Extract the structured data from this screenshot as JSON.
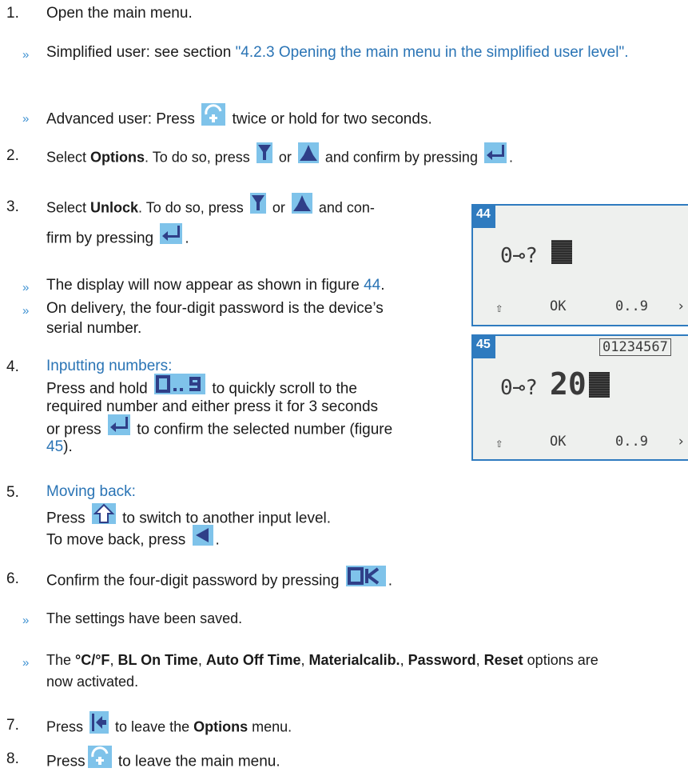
{
  "step1": {
    "num": "1.",
    "text": "Open the main menu."
  },
  "b1a": {
    "bullet": "»",
    "pre": "Simplified user: see section ",
    "link": "\"4.2.3 Opening the main menu in the simplified user level\"."
  },
  "b1b": {
    "bullet": "»",
    "pre": "Advanced user: Press",
    "post": "twice or hold for two seconds."
  },
  "step2": {
    "num": "2.",
    "pre": "Select ",
    "bold": "Options",
    "mid": ". To do so, press",
    "or": "or",
    "post": "and confirm by pressing",
    "end": "."
  },
  "step3": {
    "num": "3.",
    "pre": "Select ",
    "bold": "Unlock",
    "mid": ". To do so, press",
    "or": "or",
    "post": "and con-",
    "line2": "firm by pressing",
    "end": "."
  },
  "b3a": {
    "bullet": "»",
    "pre": "The display will now appear as shown in figure ",
    "link": "44",
    "end": "."
  },
  "b3b": {
    "bullet": "»",
    "line1": "On delivery, the four-digit password is the device’s",
    "line2": "serial number."
  },
  "step4": {
    "num": "4.",
    "title": "Inputting numbers:",
    "l1a": "Press and hold",
    "l1b": "to quickly scroll to the",
    "l2": "required number and either press it for 3 seconds",
    "l3a": "or press",
    "l3b": "to confirm the selected number (figure",
    "l4link": "45",
    "l4end": ")."
  },
  "step5": {
    "num": "5.",
    "title": "Moving back:",
    "l1a": "Press",
    "l1b": "to switch to another input level.",
    "l2a": "To move back, press",
    "l2end": "."
  },
  "step6": {
    "num": "6.",
    "pre": "Confirm the four-digit password by pressing",
    "end": "."
  },
  "b6a": {
    "bullet": "»",
    "text": "The settings have been saved."
  },
  "b6b": {
    "bullet": "»",
    "pre": "The ",
    "o1": "°C/°F",
    "s1": ", ",
    "o2": "BL On Time",
    "s2": ", ",
    "o3": "Auto Off Time",
    "s3": ", ",
    "o4": "Materialcalib.",
    "s4": ", ",
    "o5": "Password",
    "s5": ", ",
    "o6": "Reset",
    "post": " options are",
    "line2": "now activated."
  },
  "step7": {
    "num": "7.",
    "pre": "Press",
    "mid": "to leave the ",
    "bold": "Options",
    "post": " menu."
  },
  "step8": {
    "num": "8.",
    "pre": "Press",
    "post": "to leave the main menu."
  },
  "fig44": {
    "tag": "44",
    "key": "0⊸?",
    "ok": "OK",
    "range": "0..9",
    "arrow_up": "⇧",
    "arrow_right": "›"
  },
  "fig45": {
    "tag": "45",
    "serial": "01234567",
    "key": "0⊸?",
    "value": "20",
    "ok": "OK",
    "range": "0..9",
    "arrow_up": "⇧",
    "arrow_right": "›"
  },
  "icons": {
    "accent": "#2f7bbf",
    "icon_blue": "#7fc3ea"
  }
}
